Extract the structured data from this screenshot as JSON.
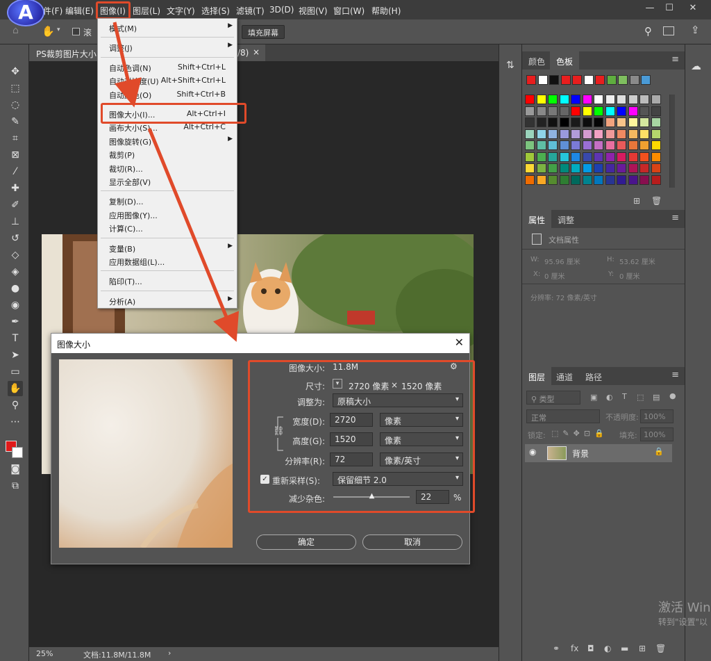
{
  "menubar": {
    "logo_letter": "A",
    "items": [
      "件(F)",
      "编辑(E)",
      "图像(I)",
      "图层(L)",
      "文字(Y)",
      "选择(S)",
      "滤镜(T)",
      "3D(D)",
      "视图(V)",
      "窗口(W)",
      "帮助(H)"
    ],
    "window_buttons": [
      "—",
      "☐",
      "✕"
    ]
  },
  "optionsbar": {
    "scroll_all_label": "滚",
    "fill_screen_label": "填充屏幕"
  },
  "document": {
    "tab_title": "PS裁剪图片大小:",
    "tab_suffix": "/8)",
    "tab_close": "×",
    "zoom": "25%",
    "doc_info": "文档:11.8M/11.8M"
  },
  "image_menu": {
    "items": [
      {
        "label": "模式(M)",
        "shortcut": "",
        "submenu": true
      },
      {
        "sep": true
      },
      {
        "label": "调整(J)",
        "shortcut": "",
        "submenu": true
      },
      {
        "sep": true
      },
      {
        "label": "自动色调(N)",
        "shortcut": "Shift+Ctrl+L"
      },
      {
        "label": "自动对比度(U)",
        "shortcut": "Alt+Shift+Ctrl+L"
      },
      {
        "label": "自动颜色(O)",
        "shortcut": "Shift+Ctrl+B"
      },
      {
        "sep": true
      },
      {
        "label": "图像大小(I)...",
        "shortcut": "Alt+Ctrl+I"
      },
      {
        "label": "画布大小(S)...",
        "shortcut": "Alt+Ctrl+C"
      },
      {
        "label": "图像旋转(G)",
        "shortcut": "",
        "submenu": true
      },
      {
        "label": "裁剪(P)",
        "shortcut": ""
      },
      {
        "label": "裁切(R)...",
        "shortcut": ""
      },
      {
        "label": "显示全部(V)",
        "shortcut": ""
      },
      {
        "sep": true
      },
      {
        "label": "复制(D)...",
        "shortcut": ""
      },
      {
        "label": "应用图像(Y)...",
        "shortcut": ""
      },
      {
        "label": "计算(C)...",
        "shortcut": ""
      },
      {
        "sep": true
      },
      {
        "label": "变量(B)",
        "shortcut": "",
        "submenu": true
      },
      {
        "label": "应用数据组(L)...",
        "shortcut": ""
      },
      {
        "sep": true
      },
      {
        "label": "陷印(T)...",
        "shortcut": ""
      },
      {
        "sep": true
      },
      {
        "label": "分析(A)",
        "shortcut": "",
        "submenu": true
      }
    ]
  },
  "image_size_dialog": {
    "title": "图像大小",
    "close": "✕",
    "image_size_label": "图像大小:",
    "image_size_value": "11.8M",
    "dimensions_label": "尺寸:",
    "dimensions_w": "2720 像素",
    "dimensions_x": "×",
    "dimensions_h": "1520 像素",
    "fit_to_label": "调整为:",
    "fit_to_value": "原稿大小",
    "width_label": "宽度(D):",
    "width_value": "2720",
    "width_unit": "像素",
    "height_label": "高度(G):",
    "height_value": "1520",
    "height_unit": "像素",
    "resolution_label": "分辨率(R):",
    "resolution_value": "72",
    "resolution_unit": "像素/英寸",
    "resample_label": "重新采样(S):",
    "resample_checked": true,
    "resample_value": "保留细节 2.0",
    "noise_label": "减少杂色:",
    "noise_value": "22",
    "noise_unit": "%",
    "noise_fraction": 0.22,
    "ok_label": "确定",
    "cancel_label": "取消"
  },
  "swatches_panel": {
    "tabs": [
      "颜色",
      "色板"
    ],
    "active_tab": "色板",
    "recent": [
      "#e81e1e",
      "#ffffff",
      "#111111",
      "#e81e1e",
      "#e81e1e",
      "#ffffff",
      "#e81e1e",
      "#5fae3f",
      "#7fbf5f",
      "#8a8a8a",
      "#4a9ad6"
    ],
    "grid": [
      [
        "#ff0000",
        "#ffff00",
        "#00ff00",
        "#00ffff",
        "#0000ff",
        "#ff00ff",
        "#ffffff",
        "#eeeeee",
        "#dddddd",
        "#cccccc",
        "#bbbbbb",
        "#aaaaaa"
      ],
      [
        "#999999",
        "#888888",
        "#777777",
        "#666666",
        "#ff0000",
        "#ffff00",
        "#00ff00",
        "#00ffff",
        "#0000ff",
        "#ff00ff",
        "#555555",
        "#444444"
      ],
      [
        "#333333",
        "#222222",
        "#111111",
        "#000000",
        "#1a1a1a",
        "#0d0d0d",
        "#050505",
        "#f1a37e",
        "#f7c38a",
        "#fff59d",
        "#d4e79e",
        "#a8d5a2"
      ],
      [
        "#9ad3bc",
        "#8fd4e8",
        "#8fb3e0",
        "#9999dd",
        "#b19cd9",
        "#d39bd0",
        "#f2a1c3",
        "#f09a9a",
        "#ef8a62",
        "#f4b860",
        "#ffe066",
        "#b5d66c"
      ],
      [
        "#7cc47f",
        "#5fbfa5",
        "#5fbfd6",
        "#5f8fd6",
        "#7a7ad6",
        "#9a6fd6",
        "#c46fc4",
        "#e86fa0",
        "#e85a5a",
        "#e8763a",
        "#f0a030",
        "#ffd800"
      ],
      [
        "#a0c83a",
        "#4caf50",
        "#26a69a",
        "#26c6da",
        "#1e88e5",
        "#3949ab",
        "#5e35b1",
        "#8e24aa",
        "#d81b60",
        "#e53935",
        "#f4511e",
        "#fb8c00"
      ],
      [
        "#fdd835",
        "#7cb342",
        "#43a047",
        "#00897b",
        "#00acc1",
        "#039be5",
        "#1e40af",
        "#4527a0",
        "#6a1b9a",
        "#ad1457",
        "#c62828",
        "#d84315"
      ],
      [
        "#ef6c00",
        "#f9a825",
        "#558b2f",
        "#2e7d32",
        "#00695c",
        "#00838f",
        "#0277bd",
        "#283593",
        "#311b92",
        "#4a148c",
        "#880e4f",
        "#b71c1c"
      ]
    ]
  },
  "properties_panel": {
    "tabs": [
      "属性",
      "调整"
    ],
    "doc_props_label": "文档属性",
    "w_label": "W:",
    "w_value": "95.96 厘米",
    "h_label": "H:",
    "h_value": "53.62 厘米",
    "x_label": "X:",
    "x_value": "0 厘米",
    "y_label": "Y:",
    "y_value": "0 厘米",
    "resolution_text": "分辨率: 72 像素/英寸"
  },
  "layers_panel": {
    "tabs": [
      "图层",
      "通道",
      "路径"
    ],
    "filter_label": "类型",
    "blend_mode": "正常",
    "opacity_label": "不透明度:",
    "opacity_value": "100%",
    "lock_label": "锁定:",
    "fill_label": "填充:",
    "fill_value": "100%",
    "layer_name": "背景"
  },
  "watermark": {
    "line1": "激活 Win",
    "line2": "转到\"设置\"以"
  },
  "colors": {
    "accent_red": "#e04a2a",
    "foreground": "#e01a1a",
    "background": "#ffffff"
  }
}
